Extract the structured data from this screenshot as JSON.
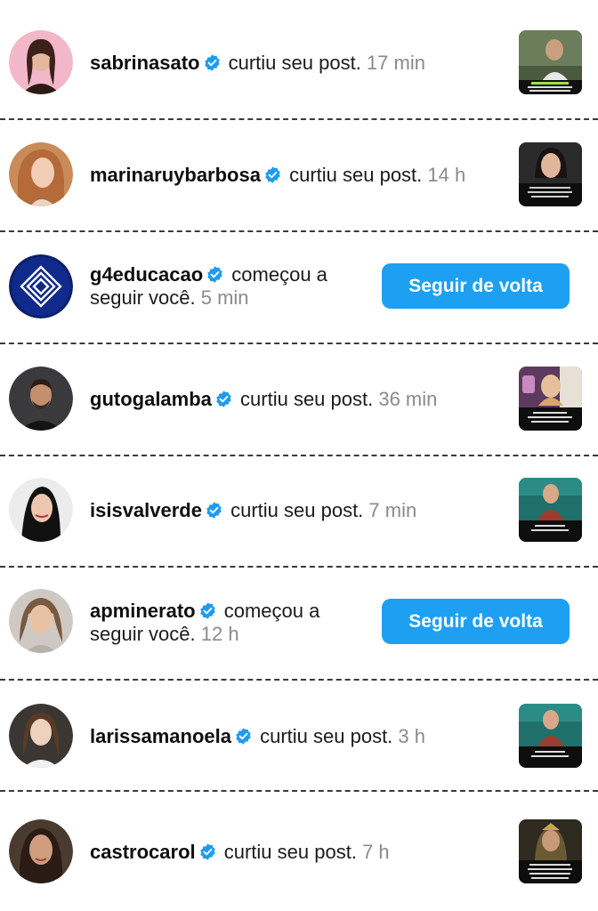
{
  "notifications": [
    {
      "username": "sabrinasato",
      "action": "curtiu seu post.",
      "time": "17 min",
      "type": "like"
    },
    {
      "username": "marinaruybarbosa",
      "action": "curtiu seu post.",
      "time": "14 h",
      "type": "like"
    },
    {
      "username": "g4educacao",
      "action_line1": "começou a",
      "action_line2": "seguir você.",
      "time": "5 min",
      "type": "follow",
      "button_label": "Seguir de volta"
    },
    {
      "username": "gutogalamba",
      "action": "curtiu seu post.",
      "time": "36 min",
      "type": "like"
    },
    {
      "username": "isisvalverde",
      "action": "curtiu seu post.",
      "time": "7 min",
      "type": "like"
    },
    {
      "username": "apminerato",
      "action_line1": "começou a",
      "action_line2": "seguir você.",
      "time": "12 h",
      "type": "follow",
      "button_label": "Seguir de volta"
    },
    {
      "username": "larissamanoela",
      "action": "curtiu seu post.",
      "time": "3 h",
      "type": "like"
    },
    {
      "username": "castrocarol",
      "action": "curtiu seu post.",
      "time": "7 h",
      "type": "like"
    }
  ],
  "colors": {
    "follow_button": "#1ea0f2",
    "verified_badge": "#1d9bf0",
    "timestamp": "#8a8a8a",
    "divider": "#3a3a3a"
  },
  "icons": {
    "verified": "verified-badge-icon",
    "g4_logo": "g4-layered-diamond-logo"
  }
}
